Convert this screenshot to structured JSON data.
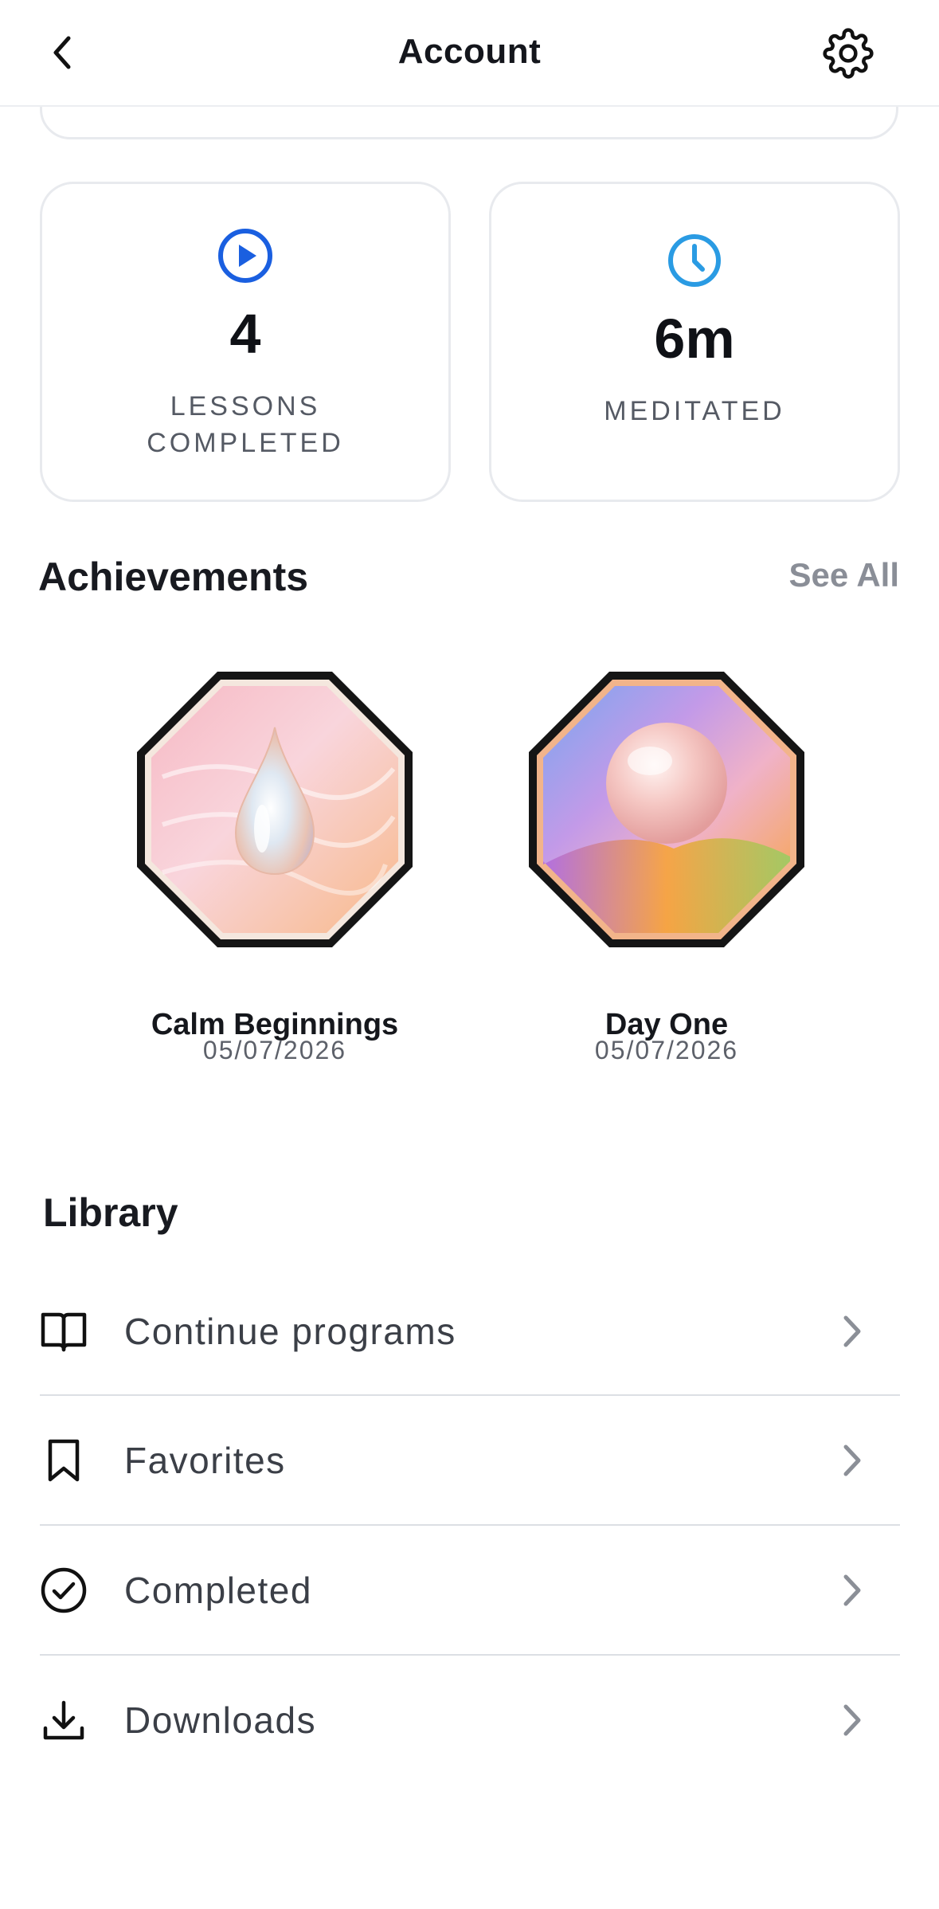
{
  "header": {
    "title": "Account",
    "back_icon": "chevron-left-icon",
    "settings_icon": "gear-icon"
  },
  "stats": [
    {
      "icon": "play-circle-icon",
      "value": "4",
      "label_line1": "LESSONS",
      "label_line2": "COMPLETED",
      "color": "#1a5fe0"
    },
    {
      "icon": "clock-icon",
      "value": "6m",
      "label_line1": "MEDITATED",
      "label_line2": "",
      "color": "#2a9be3"
    }
  ],
  "achievements": {
    "title": "Achievements",
    "see_all": "See All",
    "items": [
      {
        "name": "Calm Beginnings",
        "date": "05/07/2026",
        "art": "water-drop-badge"
      },
      {
        "name": "Day One",
        "date": "05/07/2026",
        "art": "pearl-sphere-badge"
      }
    ]
  },
  "library": {
    "title": "Library",
    "items": [
      {
        "label": "Continue programs",
        "icon": "open-book-icon"
      },
      {
        "label": "Favorites",
        "icon": "bookmark-icon"
      },
      {
        "label": "Completed",
        "icon": "check-circle-icon"
      },
      {
        "label": "Downloads",
        "icon": "download-icon"
      }
    ]
  }
}
